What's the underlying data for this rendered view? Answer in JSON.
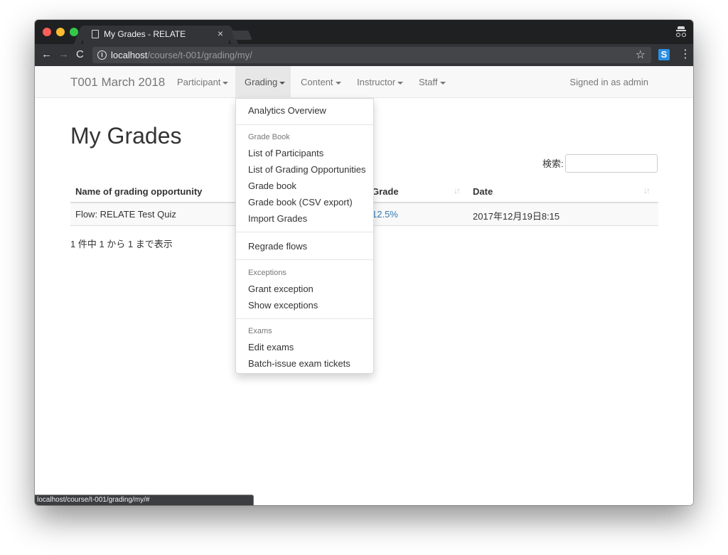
{
  "browser": {
    "tab_title": "My Grades - RELATE",
    "tab_close": "×",
    "url_host": "localhost",
    "url_path": "/course/t-001/grading/my/",
    "nav_back": "←",
    "nav_forward": "→",
    "nav_reload": "C",
    "info_icon": "i",
    "star_icon": "☆",
    "extension_icon": "S",
    "menu_icon": "⋮",
    "status_url": "localhost/course/t-001/grading/my/#"
  },
  "navbar": {
    "brand": "T001 March 2018",
    "items": [
      {
        "label": "Participant"
      },
      {
        "label": "Grading"
      },
      {
        "label": "Content"
      },
      {
        "label": "Instructor"
      },
      {
        "label": "Staff"
      }
    ],
    "signed_in": "Signed in as admin"
  },
  "main": {
    "heading": "My Grades",
    "search_label": "検索:",
    "search_value": "",
    "table": {
      "headers": [
        "Name of grading opportunity",
        "Grade",
        "Date"
      ],
      "rows": [
        {
          "name": "Flow: RELATE Test Quiz",
          "grade": "12.5%",
          "date": "2017年12月19日8:15"
        }
      ]
    },
    "info": "1 件中 1 から 1 まで表示"
  },
  "dropdown": {
    "analytics": "Analytics Overview",
    "grade_book_header": "Grade Book",
    "list_participants": "List of Participants",
    "list_opportunities": "List of Grading Opportunities",
    "grade_book": "Grade book",
    "grade_book_csv": "Grade book (CSV export)",
    "import_grades": "Import Grades",
    "regrade_flows": "Regrade flows",
    "exceptions_header": "Exceptions",
    "grant_exception": "Grant exception",
    "show_exceptions": "Show exceptions",
    "exams_header": "Exams",
    "edit_exams": "Edit exams",
    "batch_issue": "Batch-issue exam tickets"
  },
  "icons": {
    "sort": "↓↑"
  },
  "colors": {
    "link": "#337ab7",
    "navbar_bg": "#f8f8f8",
    "active_nav_bg": "#e7e7e7",
    "chrome_dark": "#1f2022"
  }
}
